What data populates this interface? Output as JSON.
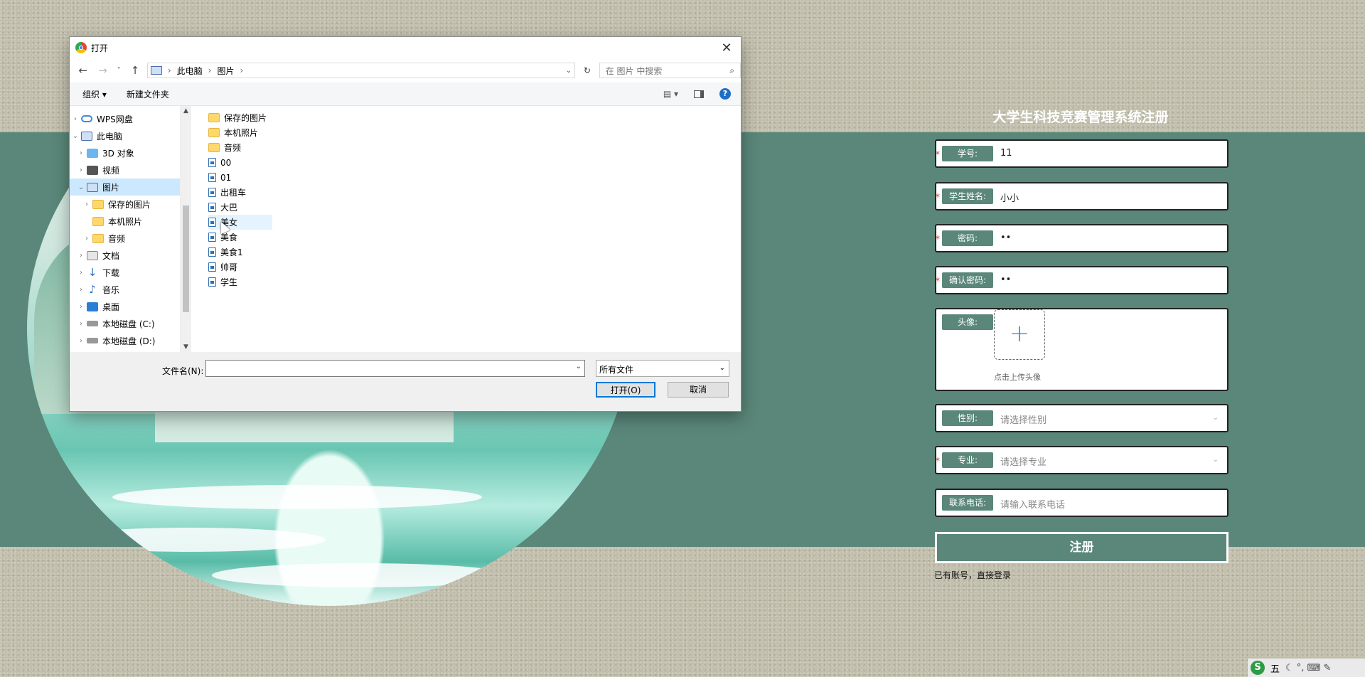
{
  "dialog": {
    "title": "打开",
    "close": "✕",
    "breadcrumb": [
      "此电脑",
      "图片"
    ],
    "search_placeholder": "在 图片 中搜索",
    "toolbar": {
      "organize": "组织 ▾",
      "new_folder": "新建文件夹",
      "view": "▤ ▾",
      "help": "?"
    },
    "tree": [
      {
        "label": "WPS网盘",
        "icon": "cloud-icon"
      },
      {
        "label": "此电脑",
        "icon": "computer-icon"
      },
      {
        "label": "3D 对象",
        "icon": "cube-icon"
      },
      {
        "label": "视频",
        "icon": "video-icon"
      },
      {
        "label": "图片",
        "icon": "pictures-icon"
      },
      {
        "label": "保存的图片",
        "icon": "folder-icon"
      },
      {
        "label": "本机照片",
        "icon": "folder-icon"
      },
      {
        "label": "音频",
        "icon": "folder-icon"
      },
      {
        "label": "文档",
        "icon": "document-icon"
      },
      {
        "label": "下载",
        "icon": "download-icon"
      },
      {
        "label": "音乐",
        "icon": "music-icon"
      },
      {
        "label": "桌面",
        "icon": "desktop-icon"
      },
      {
        "label": "本地磁盘 (C:)",
        "icon": "drive-icon"
      },
      {
        "label": "本地磁盘 (D:)",
        "icon": "drive-icon"
      }
    ],
    "files": [
      {
        "name": "保存的图片",
        "type": "folder"
      },
      {
        "name": "本机照片",
        "type": "folder"
      },
      {
        "name": "音频",
        "type": "folder"
      },
      {
        "name": "00",
        "type": "file"
      },
      {
        "name": "01",
        "type": "file"
      },
      {
        "name": "出租车",
        "type": "file"
      },
      {
        "name": "大巴",
        "type": "file"
      },
      {
        "name": "美女",
        "type": "file"
      },
      {
        "name": "美食",
        "type": "file"
      },
      {
        "name": "美食1",
        "type": "file"
      },
      {
        "name": "帅哥",
        "type": "file"
      },
      {
        "name": "学生",
        "type": "file"
      }
    ],
    "filename_label": "文件名(N):",
    "filename_value": "",
    "filetype": "所有文件",
    "open_button": "打开(O)",
    "cancel_button": "取消"
  },
  "form": {
    "title": "大学生科技竞赛管理系统注册",
    "required_mark": "*",
    "student_id": {
      "label": "学号:",
      "value": "11"
    },
    "student_name": {
      "label": "学生姓名:",
      "value": "小小"
    },
    "password": {
      "label": "密码:",
      "value": "••"
    },
    "confirm_password": {
      "label": "确认密码:",
      "value": "••"
    },
    "avatar": {
      "label": "头像:",
      "upload_icon": "+",
      "tip": "点击上传头像"
    },
    "gender": {
      "label": "性别:",
      "placeholder": "请选择性别"
    },
    "major": {
      "label": "专业:",
      "placeholder": "请选择专业"
    },
    "phone": {
      "label": "联系电话:",
      "placeholder": "请输入联系电话"
    },
    "submit": "注册",
    "login_link": "已有账号，直接登录"
  },
  "tray": {
    "ime": "S",
    "mode": "五",
    "items": "☾ °, ⌨ ✎"
  },
  "colors": {
    "accent": "#5a8779",
    "required": "#e53935"
  }
}
